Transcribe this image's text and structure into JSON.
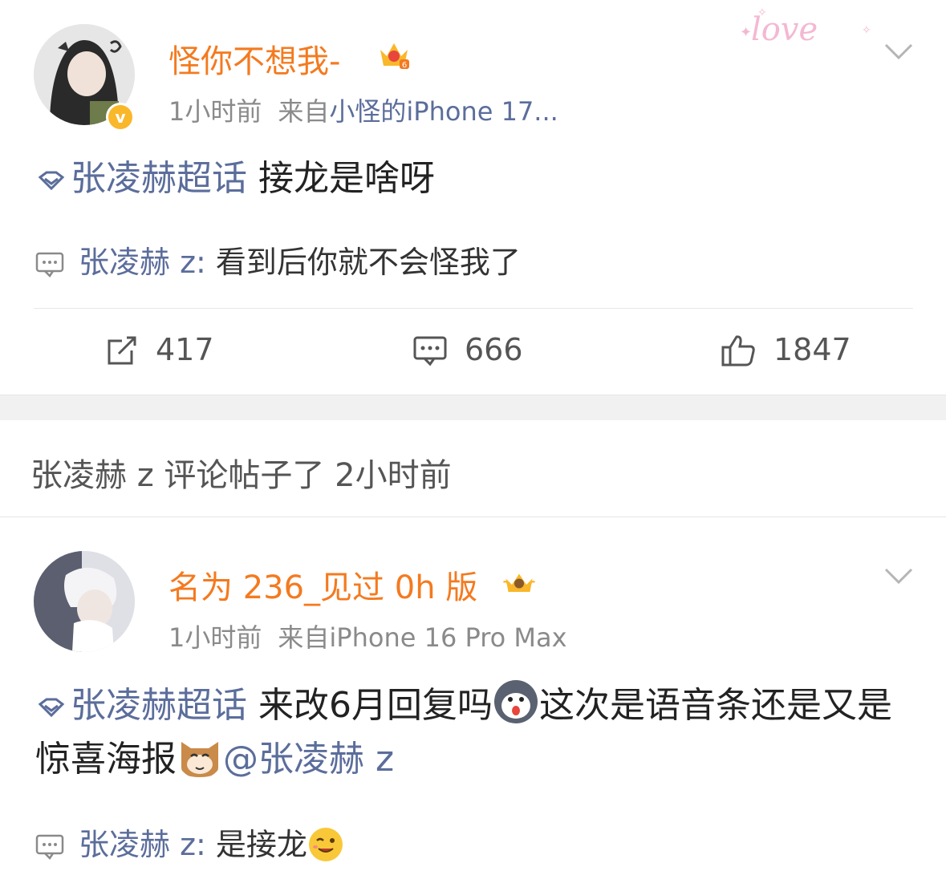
{
  "post1": {
    "username": "怪你不想我-",
    "time": "1小时前",
    "source_prefix": "来自",
    "source_device": "小怪的iPhone 17...",
    "topic": "张凌赫超话",
    "text": " 接龙是啥呀",
    "reply": {
      "name": "张凌赫 z:",
      "text": " 看到后你就不会怪我了"
    },
    "actions": {
      "repost": "417",
      "comment": "666",
      "like": "1847"
    },
    "decoration_text": "love"
  },
  "notice": {
    "text": "张凌赫 z 评论帖子了 2小时前"
  },
  "post2": {
    "username": "名为 236_见过 0h 版",
    "time": "1小时前",
    "source_prefix": "来自",
    "source_device": "iPhone 16 Pro Max",
    "topic": "张凌赫超话",
    "text_part1": " 来改6月回复吗",
    "text_part2": "这次是语音条还是又是惊喜海报",
    "mention": "@张凌赫 z",
    "reply": {
      "name": "张凌赫 z:",
      "text": " 是接龙"
    }
  },
  "colors": {
    "username": "#f47a1f",
    "link": "#5b6d9b",
    "meta": "#8a8a8a",
    "badge": "#f9b72a"
  }
}
